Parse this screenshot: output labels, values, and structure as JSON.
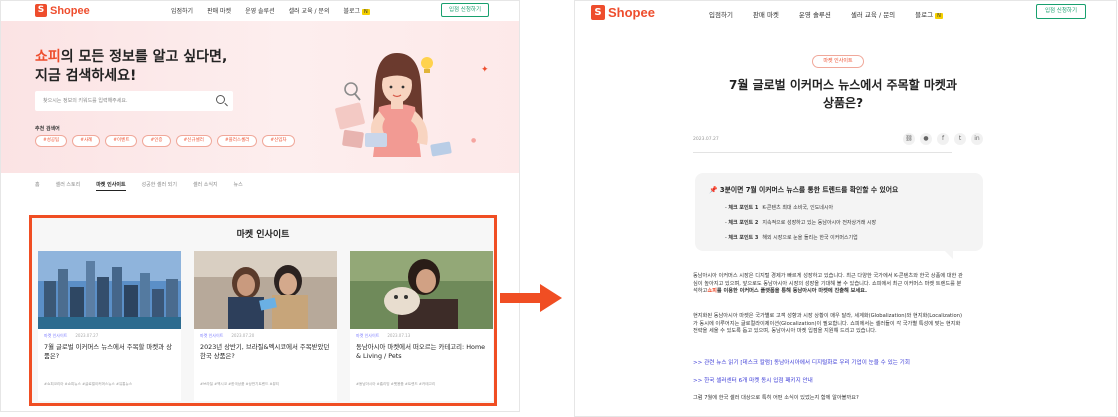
{
  "left": {
    "logo": "Shopee",
    "nav": [
      "입점하기",
      "판매 마켓",
      "운영 솔루션",
      "셀러 교육 / 문의",
      "블로그"
    ],
    "nav_badge": "N",
    "signup_button": "입점 신청하기",
    "hero": {
      "title_highlight": "쇼피",
      "title_line1": "의 모든 정보를 알고 싶다면,",
      "title_line2": "지금 검색하세요!",
      "search_placeholder": "찾으시는 정보의 키워드를 입력해주세요.",
      "tags_label": "추천 검색어",
      "tags": [
        "#성공팁",
        "#사례",
        "#이벤트",
        "#인증",
        "#신규셀러",
        "#플러스셀러",
        "#신입차"
      ]
    },
    "tabs": [
      "홈",
      "셀러 스토리",
      "마켓 인사이트",
      "성공한 셀러 되기",
      "셀러 소식지",
      "뉴스"
    ],
    "active_tab": 2,
    "panel_title": "마켓 인사이트",
    "cards": [
      {
        "category": "마켓 인사이트",
        "date": "2023.07.27",
        "title": "7월 글로벌 이커머스 뉴스에서 주목할 마켓과 상품은?",
        "tags": "#쇼피코리아 #쇼피뉴스 #글로벌이커머스뉴스 #유통뉴스"
      },
      {
        "category": "마켓 인사이트",
        "date": "2023.07.20",
        "title": "2023년 상반기, 브라질&멕시코에서 주목받았던 한국 상품은?",
        "tags": "#브라질 #멕시코 #한국상품 #상반기트렌드 #뷰티"
      },
      {
        "category": "마켓 인사이트",
        "date": "2023.07.13",
        "title": "동남아시아 마켓에서 떠오르는 카테고리: Home & Living / Pets",
        "tags": "#동남아시아 #홈리빙 #펫용품 #트렌드 #카테고리"
      }
    ]
  },
  "right": {
    "logo": "Shopee",
    "nav": [
      "입점하기",
      "판매 마켓",
      "운영 솔루션",
      "셀러 교육 / 문의",
      "블로그"
    ],
    "nav_badge": "N",
    "signup_button": "입점 신청하기",
    "category_pill": "마켓 인사이트",
    "title_line1": "7월 글로벌 이커머스 뉴스에서 주목할 마켓과",
    "title_line2": "상품은?",
    "date": "2023.07.27",
    "summary_heading": "3분이면 7월 이커머스 뉴스를 통한 트렌드를 확인할 수 있어요",
    "points": [
      {
        "label": "체크 포인트 1",
        "text": "K-콘텐츠 최대 소비국, 인도네시아"
      },
      {
        "label": "체크 포인트 2",
        "text": "지속적으로 성장하고 있는 동남아시아 전자상거래 시장"
      },
      {
        "label": "체크 포인트 3",
        "text": "해외 시장으로 눈을 돌리는 한국 이커머스기업"
      }
    ],
    "para1_a": "동남아시아 이커머스 시장은 디지털 경제가 빠르게 성장하고 있습니다. 최근 다양한 국가에서 K-콘텐츠와 한국 상품에 대한 관심이 높아지고 있으며, 앞으로도 동남아시아 시장의 성장을 기대해 볼 수 있습니다. 쇼피에서 최근 이커머스 마켓 트렌드를 분석하고",
    "para1_b": "쇼피",
    "para1_c": "를 이용한 이커머스 플랫폼을 통해 동남아시아 마켓에 진출해 보세요.",
    "para2": "현지화된 동남아시아 마켓은 국가별로 고객 성향과 시장 상황이 매우 달라, 세계화(Globalization)와 현지화(Localization)가 동시에 이루어지는 글로컬라이제이션(Glocalization)이 필요합니다. 쇼피에서는 셀러들이 각 국가별 특성에 맞는 현지화 전략을 세울 수 있도록 돕고 있으며, 동남아시아 마켓 입점을 지원해 드리고 있습니다.",
    "link1": ">> 관련 뉴스 읽기 [데스크 칼럼] 동남아시아에서 디지털화로 우리 기업이 눈을 수 있는 기회",
    "link2": ">> 한국 셀러센터 6개 마켓 동시 입점 패키지 안내",
    "para3": "그럼 7월에 한국 셀러 대상으로 특히 어떤 소식이 있었는지 함께 알아볼까요?"
  }
}
